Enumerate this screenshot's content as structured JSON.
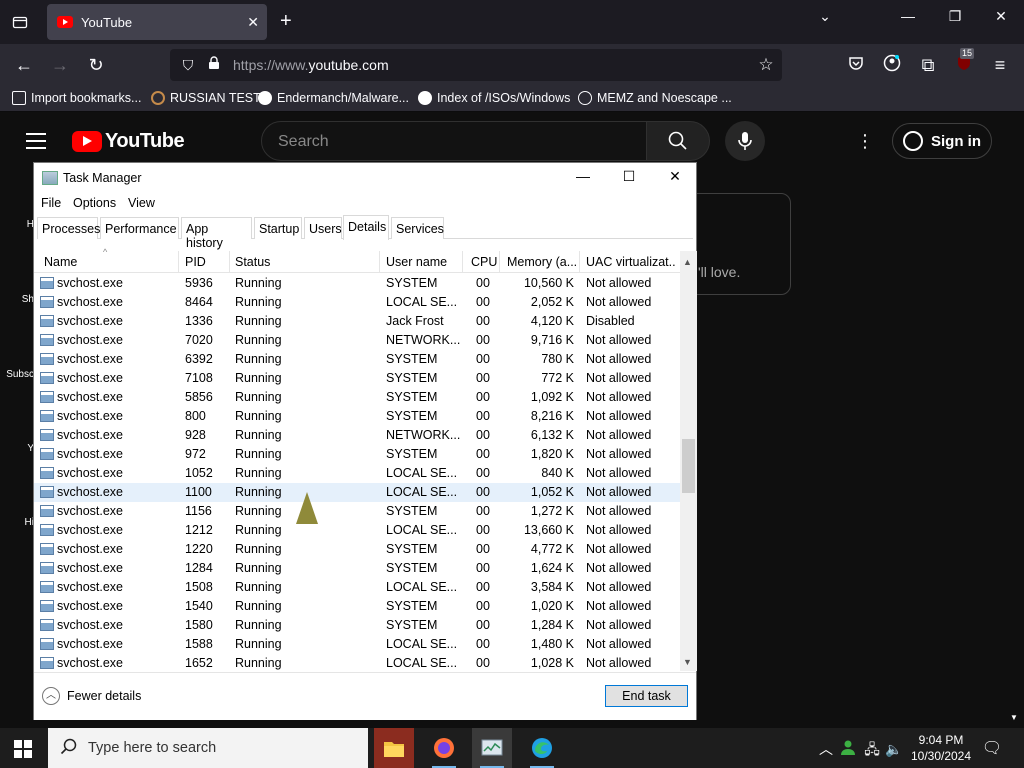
{
  "browser": {
    "tab_title": "YouTube",
    "url_prefix": "https://www.",
    "url_domain": "youtube.com",
    "extension_badge": "15",
    "bookmarks": [
      {
        "label": "Import bookmarks...",
        "icon": "import-icon"
      },
      {
        "label": "RUSSIAN TEST",
        "icon": "site-icon"
      },
      {
        "label": "Endermanch/Malware...",
        "icon": "github-icon"
      },
      {
        "label": "Index of /ISOs/Windows",
        "icon": "google-icon"
      },
      {
        "label": "MEMZ and Noescape ...",
        "icon": "globe-icon"
      }
    ]
  },
  "youtube": {
    "logo_text": "YouTube",
    "search_placeholder": "Search",
    "sign_in": "Sign in",
    "card_text": "'ll love.",
    "side_labels": [
      "H",
      "Sh",
      "Subsc",
      "Y",
      "Hi"
    ]
  },
  "task_manager": {
    "title": "Task Manager",
    "menu": [
      "File",
      "Options",
      "View"
    ],
    "tabs": [
      "Processes",
      "Performance",
      "App history",
      "Startup",
      "Users",
      "Details",
      "Services"
    ],
    "active_tab": "Details",
    "columns": [
      "Name",
      "PID",
      "Status",
      "User name",
      "CPU",
      "Memory (a...",
      "UAC virtualizat..."
    ],
    "rows": [
      [
        "svchost.exe",
        "5936",
        "Running",
        "SYSTEM",
        "00",
        "10,560 K",
        "Not allowed"
      ],
      [
        "svchost.exe",
        "8464",
        "Running",
        "LOCAL SE...",
        "00",
        "2,052 K",
        "Not allowed"
      ],
      [
        "svchost.exe",
        "1336",
        "Running",
        "Jack Frost",
        "00",
        "4,120 K",
        "Disabled"
      ],
      [
        "svchost.exe",
        "7020",
        "Running",
        "NETWORK...",
        "00",
        "9,716 K",
        "Not allowed"
      ],
      [
        "svchost.exe",
        "6392",
        "Running",
        "SYSTEM",
        "00",
        "780 K",
        "Not allowed"
      ],
      [
        "svchost.exe",
        "7108",
        "Running",
        "SYSTEM",
        "00",
        "772 K",
        "Not allowed"
      ],
      [
        "svchost.exe",
        "5856",
        "Running",
        "SYSTEM",
        "00",
        "1,092 K",
        "Not allowed"
      ],
      [
        "svchost.exe",
        "800",
        "Running",
        "SYSTEM",
        "00",
        "8,216 K",
        "Not allowed"
      ],
      [
        "svchost.exe",
        "928",
        "Running",
        "NETWORK...",
        "00",
        "6,132 K",
        "Not allowed"
      ],
      [
        "svchost.exe",
        "972",
        "Running",
        "SYSTEM",
        "00",
        "1,820 K",
        "Not allowed"
      ],
      [
        "svchost.exe",
        "1052",
        "Running",
        "LOCAL SE...",
        "00",
        "840 K",
        "Not allowed"
      ],
      [
        "svchost.exe",
        "1100",
        "Running",
        "LOCAL SE...",
        "00",
        "1,052 K",
        "Not allowed"
      ],
      [
        "svchost.exe",
        "1156",
        "Running",
        "SYSTEM",
        "00",
        "1,272 K",
        "Not allowed"
      ],
      [
        "svchost.exe",
        "1212",
        "Running",
        "LOCAL SE...",
        "00",
        "13,660 K",
        "Not allowed"
      ],
      [
        "svchost.exe",
        "1220",
        "Running",
        "SYSTEM",
        "00",
        "4,772 K",
        "Not allowed"
      ],
      [
        "svchost.exe",
        "1284",
        "Running",
        "SYSTEM",
        "00",
        "1,624 K",
        "Not allowed"
      ],
      [
        "svchost.exe",
        "1508",
        "Running",
        "LOCAL SE...",
        "00",
        "3,584 K",
        "Not allowed"
      ],
      [
        "svchost.exe",
        "1540",
        "Running",
        "SYSTEM",
        "00",
        "1,020 K",
        "Not allowed"
      ],
      [
        "svchost.exe",
        "1580",
        "Running",
        "SYSTEM",
        "00",
        "1,284 K",
        "Not allowed"
      ],
      [
        "svchost.exe",
        "1588",
        "Running",
        "LOCAL SE...",
        "00",
        "1,480 K",
        "Not allowed"
      ],
      [
        "svchost.exe",
        "1652",
        "Running",
        "LOCAL SE...",
        "00",
        "1,028 K",
        "Not allowed"
      ]
    ],
    "selected_row": 11,
    "fewer_details": "Fewer details",
    "end_task": "End task"
  },
  "taskbar": {
    "search_placeholder": "Type here to search",
    "apps": [
      "file-explorer-icon",
      "firefox-icon",
      "task-manager-icon",
      "edge-icon"
    ],
    "time": "9:04 PM",
    "date": "10/30/2024"
  }
}
